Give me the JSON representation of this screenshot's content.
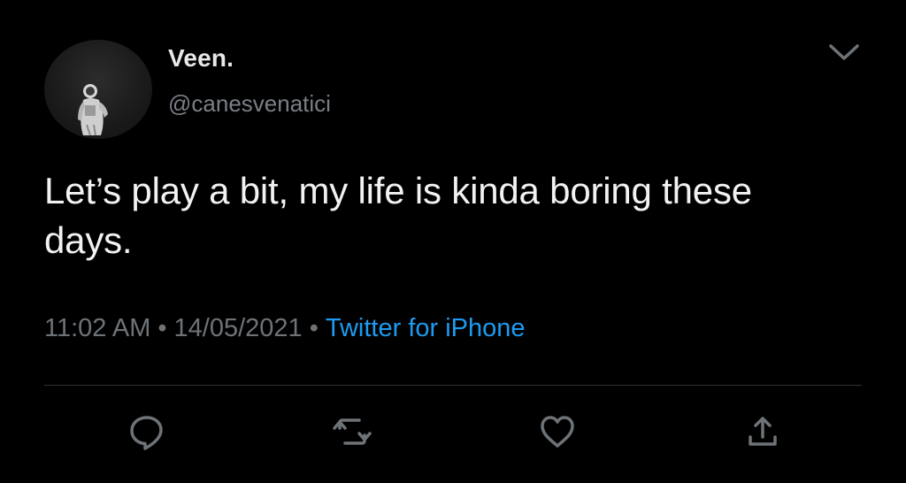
{
  "tweet": {
    "author": {
      "display_name": "Veen.",
      "handle": "@canesvenatici",
      "avatar": "astronaut-avatar"
    },
    "text": "Let’s play a bit, my life is kinda boring these days.",
    "time": "11:02 AM",
    "date": "14/05/2021",
    "separator": "•",
    "source": "Twitter for iPhone"
  },
  "actions": [
    {
      "name": "reply",
      "icon": "reply-icon"
    },
    {
      "name": "retweet",
      "icon": "retweet-icon"
    },
    {
      "name": "like",
      "icon": "heart-icon"
    },
    {
      "name": "share",
      "icon": "share-icon"
    }
  ],
  "colors": {
    "background": "#000000",
    "text": "#f2f2f2",
    "muted": "#6e7378",
    "link": "#1d9bf0",
    "divider": "#2f3336"
  }
}
